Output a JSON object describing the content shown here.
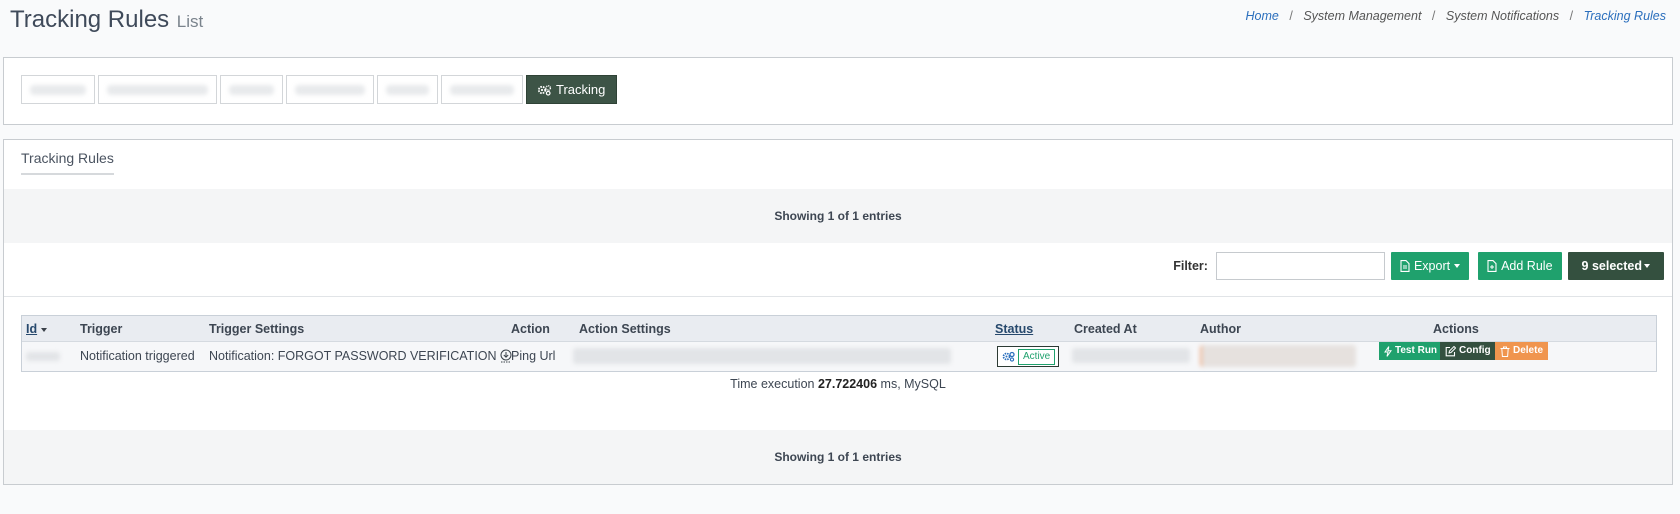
{
  "page": {
    "title": "Tracking Rules",
    "subtitle": "List"
  },
  "breadcrumb": {
    "items": [
      "Home",
      "System Management",
      "System Notifications",
      "Tracking Rules"
    ]
  },
  "top_tabs": {
    "active_label": "Tracking",
    "active_icon": "cogs-icon"
  },
  "section": {
    "title": "Tracking Rules",
    "showing_top": "Showing 1 of 1 entries",
    "showing_bottom": "Showing 1 of 1 entries"
  },
  "toolbar": {
    "filter_label": "Filter:",
    "filter_value": "",
    "export_label": "Export",
    "add_label": "Add Rule",
    "selected_label": "9 selected"
  },
  "table": {
    "headers": {
      "id": "Id",
      "trigger": "Trigger",
      "trigger_settings": "Trigger Settings",
      "action": "Action",
      "action_settings": "Action Settings",
      "status": "Status",
      "created_at": "Created At",
      "author": "Author",
      "actions": "Actions"
    },
    "rows": [
      {
        "trigger": "Notification triggered",
        "trigger_settings": "Notification: FORGOT PASSWORD VERIFICATION",
        "action": "Ping Url",
        "status": "Active",
        "buttons": {
          "test_run": "Test Run",
          "config": "Config",
          "delete": "Delete"
        }
      }
    ]
  },
  "footer": {
    "time_prefix": "Time execution",
    "time_value": "27.722406",
    "time_suffix": "ms, MySQL"
  },
  "colors": {
    "accent_green": "#1fa16d",
    "dark_green": "#34503f",
    "delete_orange": "#f0954e",
    "link_blue": "#2b6fbd"
  }
}
